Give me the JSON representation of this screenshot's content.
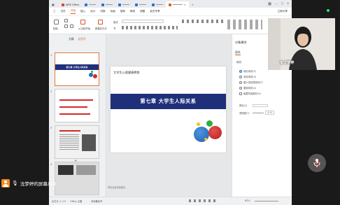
{
  "titlebar": {
    "tabs": [
      {
        "label": "WPS Office",
        "icon": "wps-icon"
      },
      {
        "label": "",
        "icon": "doc-icon"
      },
      {
        "label": "",
        "icon": "doc-icon"
      },
      {
        "label": "",
        "icon": "doc-icon"
      },
      {
        "label": "",
        "icon": "doc-icon"
      },
      {
        "label": "",
        "icon": "doc-icon"
      },
      {
        "label": "",
        "icon": "ppt-icon"
      }
    ]
  },
  "menubar": {
    "items": [
      "三",
      "文件",
      "开始",
      "插入",
      "设计",
      "切换",
      "动画",
      "放映",
      "审阅",
      "视图",
      "会员专享"
    ],
    "active": "开始",
    "right": "立即分享"
  },
  "toolbar": {
    "paste": "粘贴",
    "from_start": "从当前开始",
    "new_slide": "新建幻灯片",
    "layout": "版式",
    "section": "节"
  },
  "leftpanel": {
    "tabs": [
      "大纲",
      "幻灯片"
    ],
    "active_tab": "幻灯片",
    "slides": [
      {
        "num": "1",
        "title": "第七章 大学生人际关系"
      },
      {
        "num": "2"
      },
      {
        "num": "3"
      },
      {
        "num": "4"
      }
    ]
  },
  "slide": {
    "header": "大学生心理健康教育",
    "banner": "第七章  大学生人际关系",
    "notes_placeholder": "单击此处添加备注"
  },
  "rightpanel": {
    "title": "对象属性",
    "subtitle": "填充",
    "section": "填充",
    "options": [
      "纯色填充(S)",
      "渐变填充(G)",
      "图片或纹理填充(P)",
      "图案填充(A)",
      "隐藏背景图形(H)"
    ],
    "selected_option": "纯色填充(S)",
    "color_label": "颜色(C)",
    "transparency_label": "透明度(T)",
    "transparency_value": "0 %"
  },
  "statusbar": {
    "slide_info": "幻灯片 1 / 37",
    "theme": "Office 主题",
    "backup": "本地备份开",
    "zoom": "63%"
  },
  "webcam": {
    "name": "沈梦婷"
  },
  "share": {
    "label": "沈梦婷的屏幕共享"
  },
  "colors": {
    "banner": "#1f2f7a",
    "accent": "#d7572a",
    "circle_blue": "#1f6fc4",
    "circle_red": "#d22a2a",
    "circle_green": "#2cae3c",
    "circle_yellow": "#f2c21d"
  }
}
